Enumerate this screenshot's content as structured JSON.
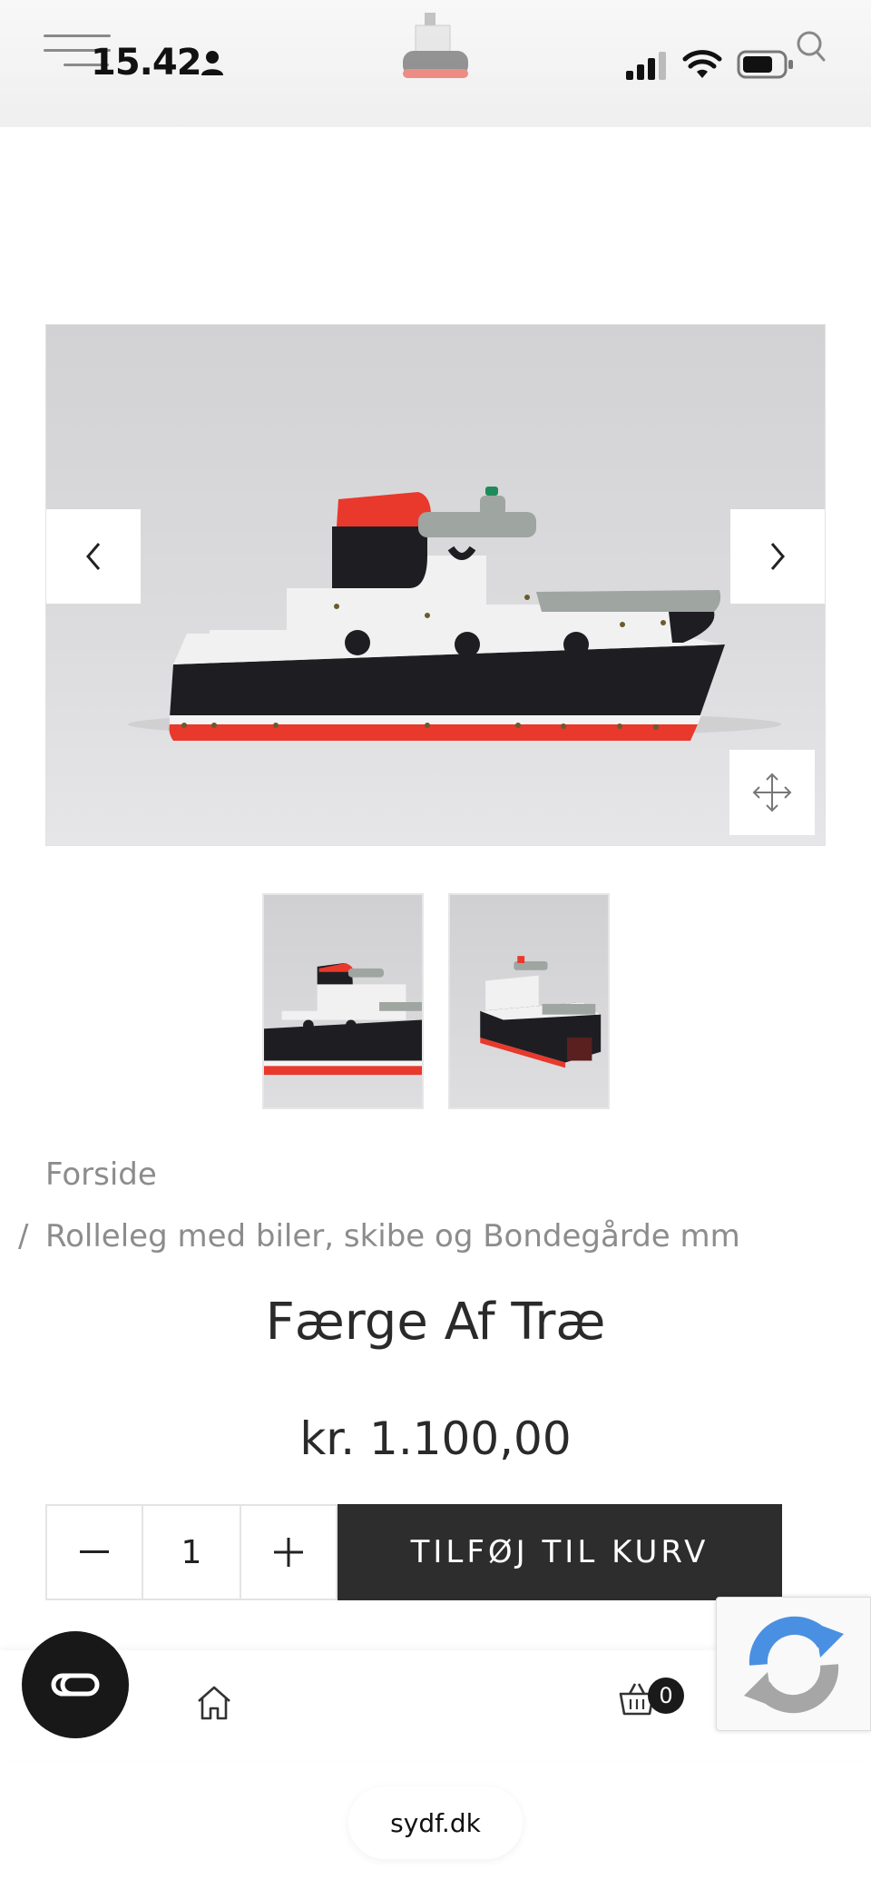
{
  "status_bar": {
    "time": "15.42"
  },
  "icons": {
    "menu": "hamburger-icon",
    "user": "person-icon",
    "logo": "ferry-logo",
    "signal": "signal-icon",
    "wifi": "wifi-icon",
    "battery": "battery-icon",
    "search": "search-icon",
    "prev": "chevron-left-icon",
    "next": "chevron-right-icon",
    "zoom": "move-arrows-icon",
    "minus": "minus-icon",
    "plus": "plus-icon",
    "chat": "co-chat-icon",
    "home": "home-icon",
    "cart": "basket-icon",
    "recaptcha": "recaptcha-icon"
  },
  "breadcrumb": {
    "home": "Forside",
    "separator": "/",
    "category": "Rolleleg med biler, skibe og Bondegårde mm"
  },
  "product": {
    "title": "Færge Af Træ",
    "price": "kr. 1.100,00",
    "quantity": "1",
    "add_to_cart_label": "TILFØJ TIL KURV"
  },
  "cart": {
    "count": "0"
  },
  "browser": {
    "url": "sydf.dk"
  },
  "colors": {
    "hull_black": "#1e1e22",
    "hull_red": "#e8392c",
    "cabin_white": "#f1f1f1",
    "deck_grey": "#9fa5a1",
    "button_dark": "#2d2d2d",
    "recaptcha_blue": "#4a90e2"
  }
}
